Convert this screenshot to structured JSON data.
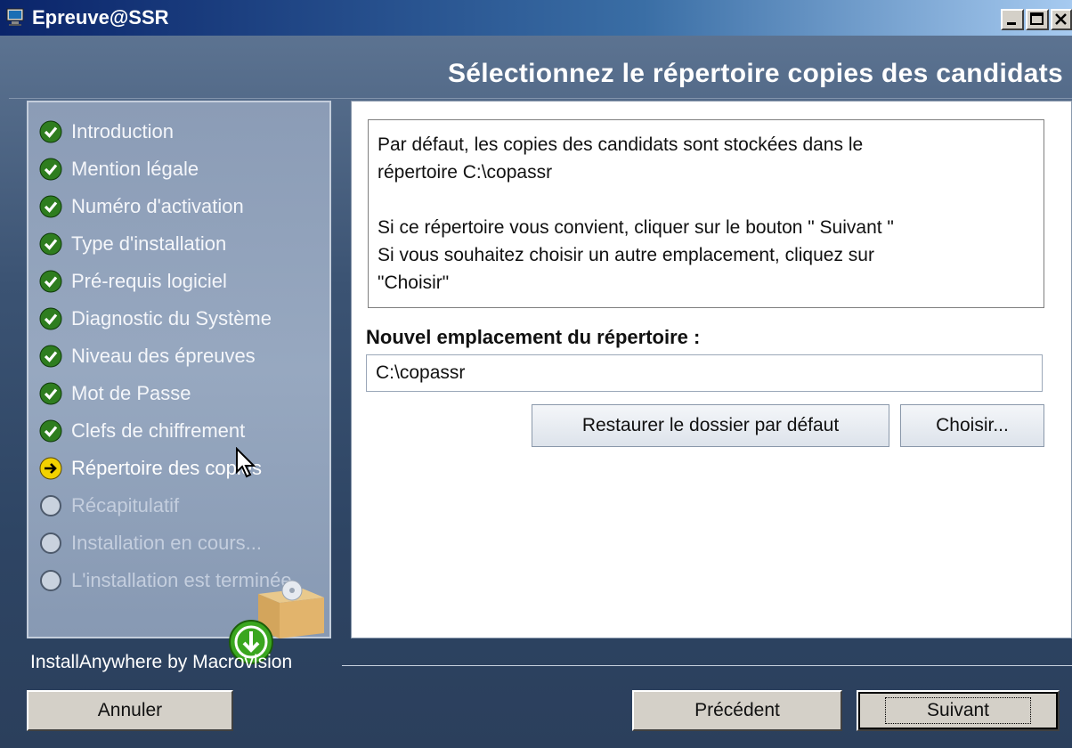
{
  "window": {
    "title": "Epreuve@SSR"
  },
  "header": {
    "title": "Sélectionnez le répertoire copies des candidats"
  },
  "steps": [
    {
      "label": "Introduction",
      "status": "done"
    },
    {
      "label": "Mention légale",
      "status": "done"
    },
    {
      "label": "Numéro d'activation",
      "status": "done"
    },
    {
      "label": "Type d'installation",
      "status": "done"
    },
    {
      "label": "Pré-requis logiciel",
      "status": "done"
    },
    {
      "label": "Diagnostic du Système",
      "status": "done"
    },
    {
      "label": "Niveau des épreuves",
      "status": "done"
    },
    {
      "label": "Mot de Passe",
      "status": "done"
    },
    {
      "label": "Clefs de chiffrement",
      "status": "done"
    },
    {
      "label": "Répertoire des copies",
      "status": "current"
    },
    {
      "label": "Récapitulatif",
      "status": "todo"
    },
    {
      "label": "Installation en cours...",
      "status": "todo"
    },
    {
      "label": "L'installation est terminée.",
      "status": "todo"
    }
  ],
  "content": {
    "info_line1": "Par défaut, les copies des candidats sont stockées dans le",
    "info_line2": "répertoire C:\\copassr",
    "info_line3": "Si ce répertoire vous convient, cliquer sur le bouton \" Suivant \"",
    "info_line4": "Si vous souhaitez choisir un autre emplacement, cliquez sur",
    "info_line5": "\"Choisir\"",
    "field_label": "Nouvel emplacement du répertoire :",
    "field_value": "C:\\copassr",
    "restore_label": "Restaurer le dossier par défaut",
    "choose_label": "Choisir..."
  },
  "footer": {
    "brand": "InstallAnywhere by Macrovision",
    "cancel_label": "Annuler",
    "previous_label": "Précédent",
    "next_label": "Suivant"
  },
  "colors": {
    "done_icon": "#2e7d1f",
    "current_icon": "#f2d200",
    "titlebar": "#0a246a"
  },
  "icons": {
    "done": "check-circle-icon",
    "current": "arrow-right-circle-icon",
    "todo": "empty-circle-icon"
  }
}
